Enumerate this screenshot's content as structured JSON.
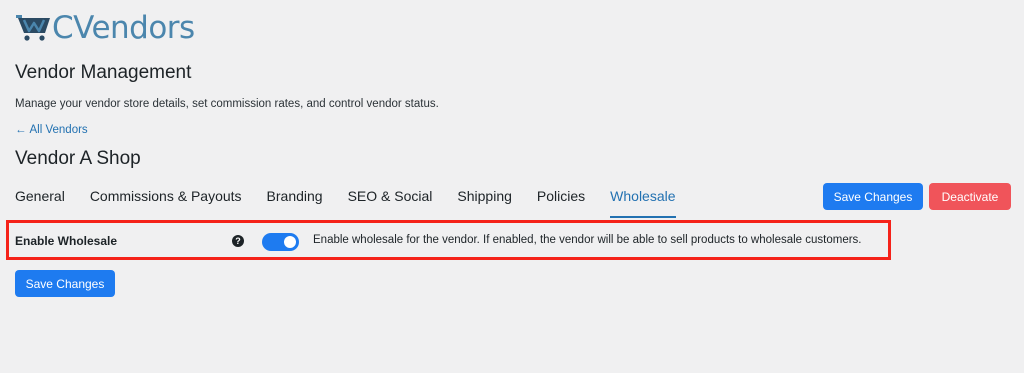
{
  "brand": {
    "name": "WCVendors",
    "logo_text": "CVendors",
    "color": "#4b86ad"
  },
  "page": {
    "title": "Vendor Management",
    "description": "Manage your vendor store details, set commission rates, and control vendor status."
  },
  "back_link": {
    "arrow": "←",
    "label": "All Vendors"
  },
  "vendor": {
    "name": "Vendor A Shop"
  },
  "tabs": [
    {
      "label": "General",
      "active": false
    },
    {
      "label": "Commissions & Payouts",
      "active": false
    },
    {
      "label": "Branding",
      "active": false
    },
    {
      "label": "SEO & Social",
      "active": false
    },
    {
      "label": "Shipping",
      "active": false
    },
    {
      "label": "Policies",
      "active": false
    },
    {
      "label": "Wholesale",
      "active": true
    }
  ],
  "actions": {
    "save_label": "Save Changes",
    "deactivate_label": "Deactivate"
  },
  "wholesale": {
    "label": "Enable Wholesale",
    "help_icon": "?",
    "enabled": true,
    "description": "Enable wholesale for the vendor. If enabled, the vendor will be able to sell products to wholesale customers."
  },
  "footer": {
    "save_label": "Save Changes"
  },
  "colors": {
    "accent": "#1e7bf0",
    "danger": "#f0545a",
    "highlight": "#f5221a",
    "link": "#2271b1"
  }
}
